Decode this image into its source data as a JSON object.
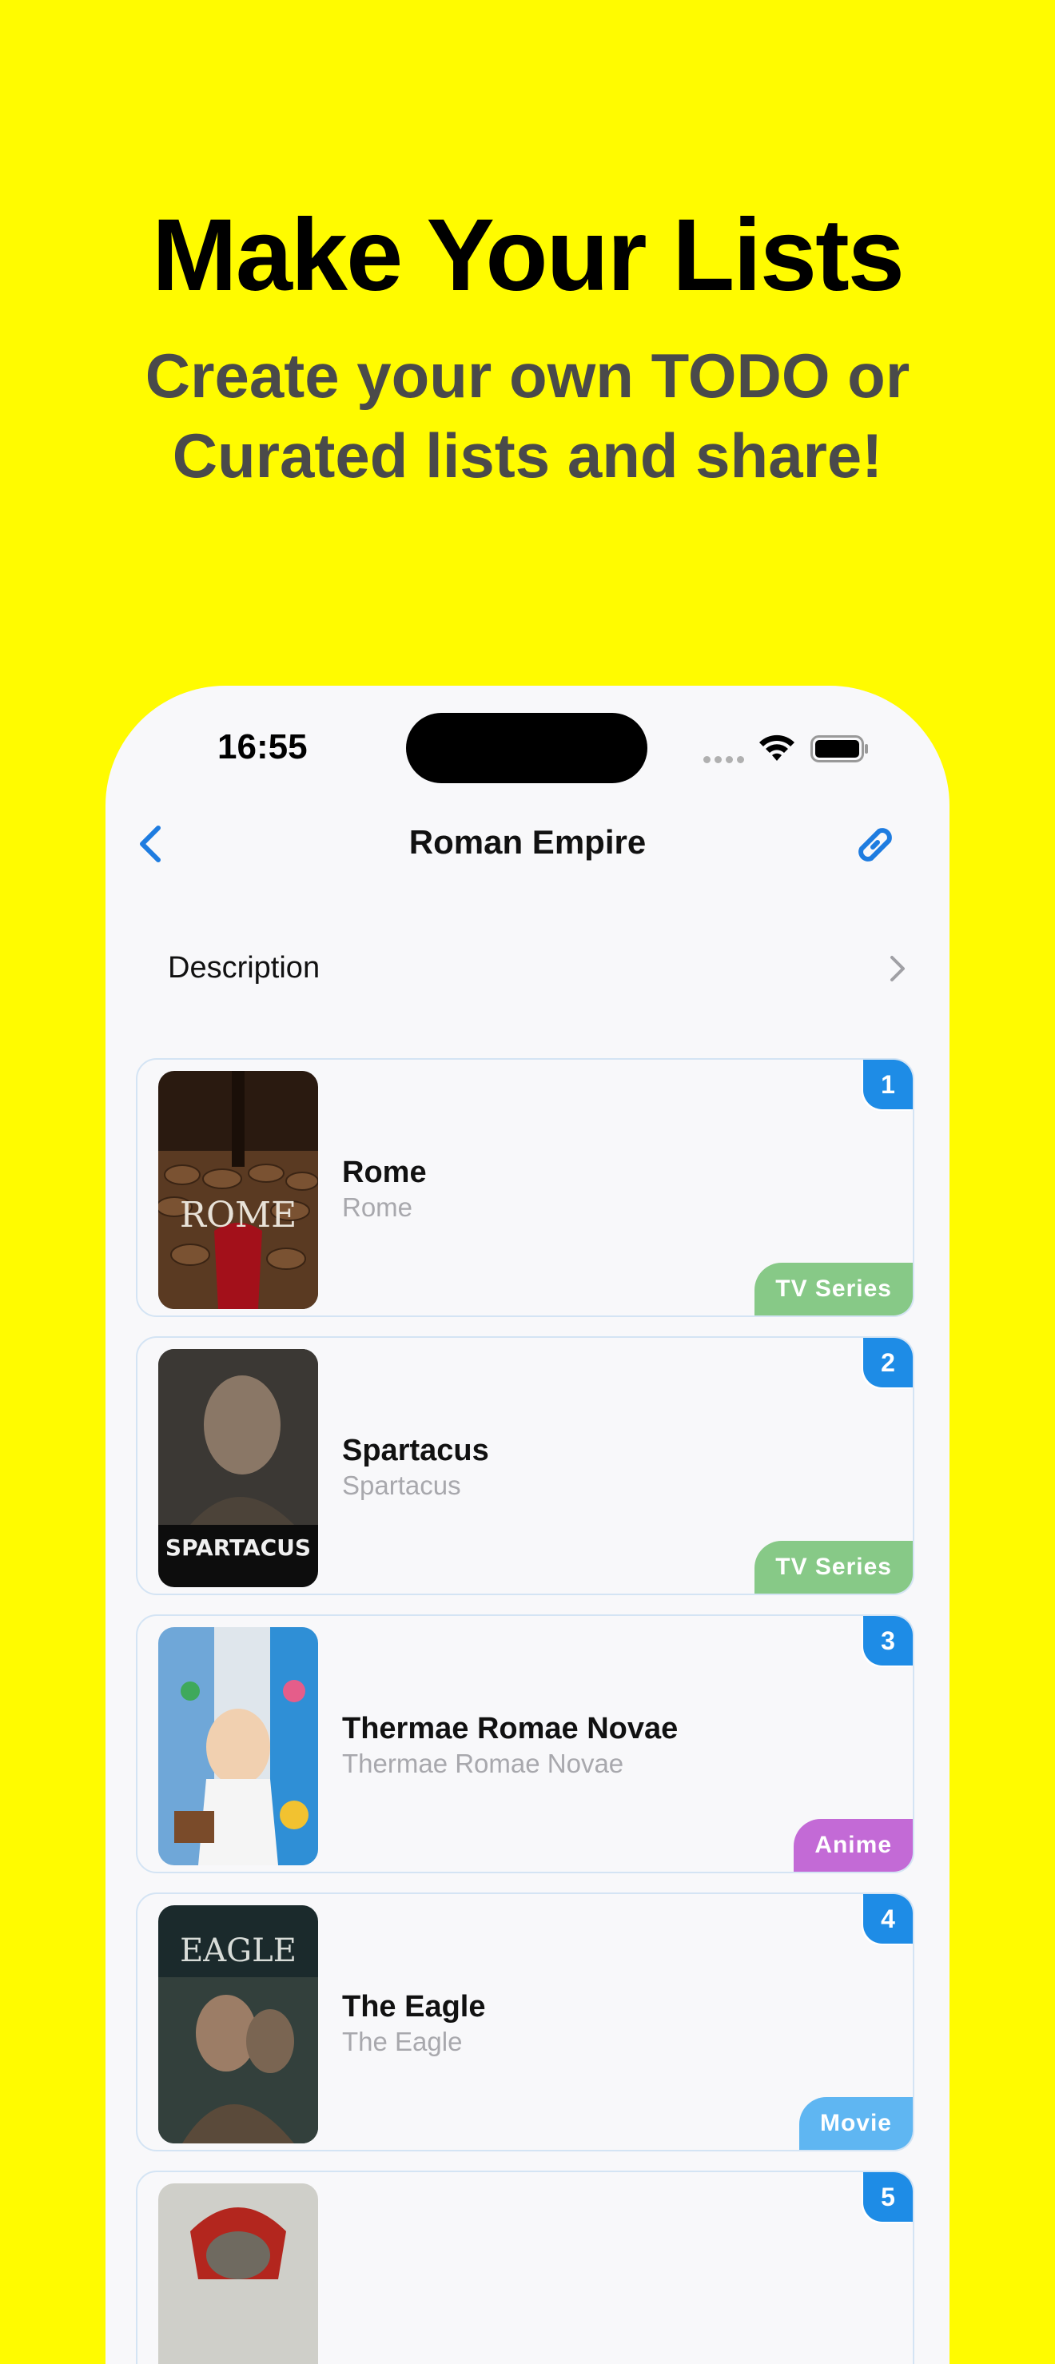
{
  "header": {
    "headline": "Make Your Lists",
    "subline_1": "Create your own TODO or",
    "subline_2": "Curated lists and share!"
  },
  "status_bar": {
    "time": "16:55"
  },
  "nav": {
    "title": "Roman Empire"
  },
  "description_row": {
    "label": "Description"
  },
  "items": [
    {
      "rank": "1",
      "title": "Rome",
      "subtitle": "Rome",
      "tag": "TV Series",
      "tag_color": "#87C987",
      "poster_text": "ROME"
    },
    {
      "rank": "2",
      "title": "Spartacus",
      "subtitle": "Spartacus",
      "tag": "TV Series",
      "tag_color": "#87C987",
      "poster_text": "SPARTACUS"
    },
    {
      "rank": "3",
      "title": "Thermae Romae Novae",
      "subtitle": "Thermae Romae Novae",
      "tag": "Anime",
      "tag_color": "#C36AD6",
      "poster_text": ""
    },
    {
      "rank": "4",
      "title": "The Eagle",
      "subtitle": "The Eagle",
      "tag": "Movie",
      "tag_color": "#5FB6F2",
      "poster_text": "EAGLE"
    },
    {
      "rank": "5",
      "title": "",
      "subtitle": "",
      "tag": "",
      "tag_color": "",
      "poster_text": ""
    }
  ],
  "colors": {
    "background": "#FFFB00",
    "accent": "#1E8CE6"
  }
}
